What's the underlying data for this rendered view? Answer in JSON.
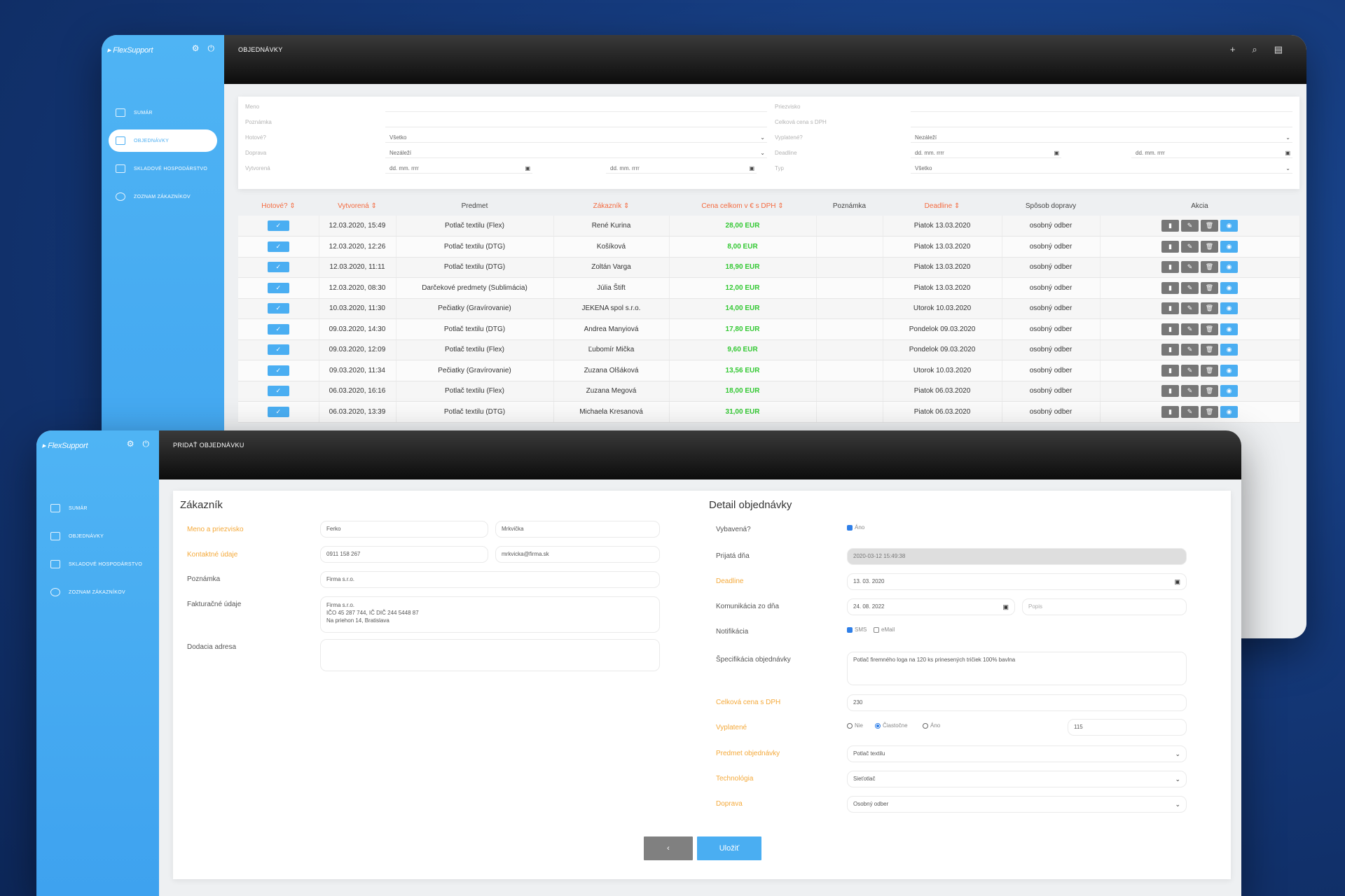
{
  "orders_window": {
    "logo": "FlexSupport",
    "title": "OBJEDNÁVKY",
    "nav": [
      {
        "label": "SUMÁR"
      },
      {
        "label": "OBJEDNÁVKY"
      },
      {
        "label": "SKLADOVÉ HOSPODÁRSTVO"
      },
      {
        "label": "ZOZNAM ZÁKAZNÍKOV"
      }
    ],
    "filters": {
      "meno": "Meno",
      "poznamka": "Poznámka",
      "hotove": "Hotové?",
      "hotove_val": "Všetko",
      "doprava": "Doprava",
      "doprava_val": "Nezáleží",
      "vytvorena": "Vytvorená",
      "date_ph": "dd. mm. rrrr",
      "priezvisko": "Priezvisko",
      "cena": "Celková cena s DPH",
      "vyplatene": "Vyplatené?",
      "vyplatene_val": "Nezáleží",
      "deadline": "Deadline",
      "typ": "Typ",
      "typ_val": "Všetko"
    },
    "columns": [
      "Hotové?",
      "Vytvorená",
      "Predmet",
      "Zákazník",
      "Cena celkom v € s DPH",
      "Poznámka",
      "Deadline",
      "Spôsob dopravy",
      "Akcia"
    ],
    "rows": [
      {
        "created": "12.03.2020, 15:49",
        "subject": "Potlač textilu (Flex)",
        "customer": "René Kurina",
        "price": "28,00 EUR",
        "deadline": "Piatok 13.03.2020",
        "shipping": "osobný odber"
      },
      {
        "created": "12.03.2020, 12:26",
        "subject": "Potlač textilu (DTG)",
        "customer": "Košíková",
        "price": "8,00 EUR",
        "deadline": "Piatok 13.03.2020",
        "shipping": "osobný odber"
      },
      {
        "created": "12.03.2020, 11:11",
        "subject": "Potlač textilu (DTG)",
        "customer": "Zoltán Varga",
        "price": "18,90 EUR",
        "deadline": "Piatok 13.03.2020",
        "shipping": "osobný odber"
      },
      {
        "created": "12.03.2020, 08:30",
        "subject": "Darčekové predmety (Sublimácia)",
        "customer": "Júlia Štift",
        "price": "12,00 EUR",
        "deadline": "Piatok 13.03.2020",
        "shipping": "osobný odber"
      },
      {
        "created": "10.03.2020, 11:30",
        "subject": "Pečiatky (Gravírovanie)",
        "customer": "JEKENA spol s.r.o.",
        "price": "14,00 EUR",
        "deadline": "Utorok 10.03.2020",
        "shipping": "osobný odber"
      },
      {
        "created": "09.03.2020, 14:30",
        "subject": "Potlač textilu (DTG)",
        "customer": "Andrea Manyiová",
        "price": "17,80 EUR",
        "deadline": "Pondelok 09.03.2020",
        "shipping": "osobný odber"
      },
      {
        "created": "09.03.2020, 12:09",
        "subject": "Potlač textilu (Flex)",
        "customer": "Ľubomír Mička",
        "price": "9,60 EUR",
        "deadline": "Pondelok 09.03.2020",
        "shipping": "osobný odber"
      },
      {
        "created": "09.03.2020, 11:34",
        "subject": "Pečiatky (Gravírovanie)",
        "customer": "Zuzana Olšáková",
        "price": "13,56 EUR",
        "deadline": "Utorok 10.03.2020",
        "shipping": "osobný odber"
      },
      {
        "created": "06.03.2020, 16:16",
        "subject": "Potlač textilu (Flex)",
        "customer": "Zuzana Megová",
        "price": "18,00 EUR",
        "deadline": "Piatok 06.03.2020",
        "shipping": "osobný odber"
      },
      {
        "created": "06.03.2020, 13:39",
        "subject": "Potlač textilu (DTG)",
        "customer": "Michaela Kresanová",
        "price": "31,00 EUR",
        "deadline": "Piatok 06.03.2020",
        "shipping": "osobný odber"
      }
    ]
  },
  "add_window": {
    "logo": "FlexSupport",
    "title": "PRIDAŤ OBJEDNÁVKU",
    "nav": [
      {
        "label": "SUMÁR"
      },
      {
        "label": "OBJEDNÁVKY"
      },
      {
        "label": "SKLADOVÉ HOSPODÁRSTVO"
      },
      {
        "label": "ZOZNAM ZÁKAZNÍKOV"
      }
    ],
    "customer": {
      "heading": "Zákazník",
      "name_lbl": "Meno a priezvisko",
      "first": "Ferko",
      "last": "Mrkvička",
      "contact_lbl": "Kontaktné údaje",
      "phone": "0911 158 267",
      "email": "mrkvicka@firma.sk",
      "note_lbl": "Poznámka",
      "note": "Firma s.r.o.",
      "billing_lbl": "Fakturačné údaje",
      "billing": [
        "Firma s.r.o.",
        "IČO 45 287 744, IČ DIČ 244 5448 87",
        "Na priehon 14, Bratislava"
      ],
      "delivery_lbl": "Dodacia adresa"
    },
    "detail": {
      "heading": "Detail objednávky",
      "picked_lbl": "Vybavená?",
      "picked_opt": "Áno",
      "received_lbl": "Prijatá dňa",
      "received": "2020-03-12 15:49:38",
      "deadline_lbl": "Deadline",
      "deadline": "13. 03. 2020",
      "comm_lbl": "Komunikácia zo dňa",
      "comm": "24. 08. 2022",
      "comm_ph": "Popis",
      "notif_lbl": "Notifikácia",
      "sms": "SMS",
      "emailopt": "eMail",
      "spec_lbl": "Špecifikácia objednávky",
      "spec": "Potlač firemného loga na 120 ks prinesených tričiek 100% bavlna",
      "price_lbl": "Celková cena s DPH",
      "price": "230",
      "paid_lbl": "Vyplatené",
      "paid_opts": [
        "Nie",
        "Čiastočne",
        "Áno"
      ],
      "paid_amount": "115",
      "subject_lbl": "Predmet objednávky",
      "subject": "Potlač textilu",
      "tech_lbl": "Technológia",
      "tech": "Sieťotlač",
      "ship_lbl": "Doprava",
      "ship": "Osobný odber"
    },
    "buttons": {
      "back": "‹",
      "save": "Uložiť"
    }
  },
  "colors": {
    "accent": "#4aaef2",
    "orange": "#f4a93a",
    "price_green": "#32c832"
  }
}
